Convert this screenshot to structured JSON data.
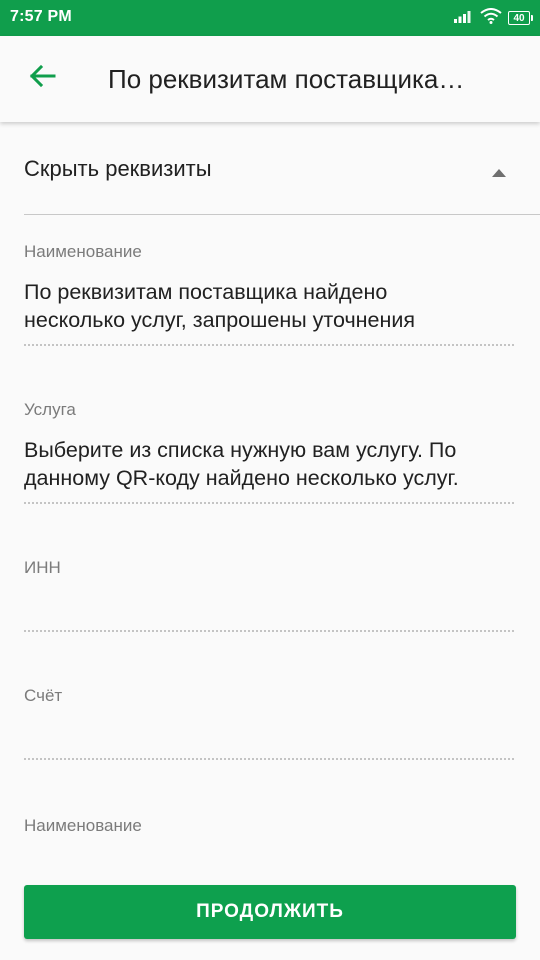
{
  "status_bar": {
    "time": "7:57 PM",
    "battery": "40",
    "icons": [
      "signal-icon",
      "wifi-icon",
      "battery-icon"
    ],
    "color": "#109e4c"
  },
  "app_bar": {
    "title": "По реквизитам поставщика…",
    "back_icon": "arrow-back-icon",
    "accent": "#109e4c"
  },
  "collapse": {
    "label": "Скрыть реквизиты",
    "icon": "triangle-up-icon"
  },
  "fields": [
    {
      "label": "Наименование",
      "value_line1": "По реквизитам поставщика найдено",
      "value_line2": "несколько услуг, запрошены уточнения"
    },
    {
      "label": "Услуга",
      "value_line1": "Выберите из списка нужную вам услугу. По",
      "value_line2": "данному QR-коду найдено несколько услуг."
    },
    {
      "label": "ИНН",
      "value": ""
    },
    {
      "label": "Счёт",
      "value": ""
    },
    {
      "label": "Наименование",
      "value": ""
    }
  ],
  "continue_button": {
    "label": "ПРОДОЛЖИТЬ",
    "color": "#0ea04e"
  }
}
